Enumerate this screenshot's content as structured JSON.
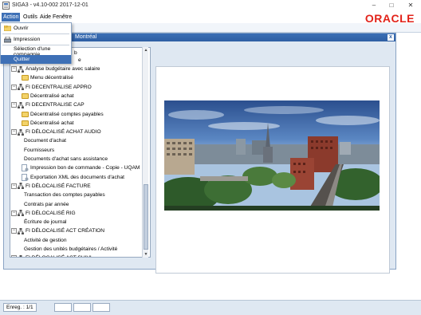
{
  "window": {
    "title": "SIGA3 - v4.10-002 2017-12-01",
    "controls": {
      "minimize": "–",
      "maximize": "□",
      "close": "✕"
    }
  },
  "menubar": {
    "items": [
      "Action",
      "Outils",
      "Aide",
      "Fenêtre"
    ],
    "active": "Action",
    "logo": "ORACLE"
  },
  "dropdown": {
    "items": [
      {
        "label": "Ouvrir",
        "icon": "folder-open-icon"
      },
      {
        "label": "Impression",
        "icon": "printer-icon"
      },
      {
        "label": "Sélection d'une compagnie"
      },
      {
        "label": "Quitter",
        "selected": true
      }
    ]
  },
  "inner_window": {
    "title": "Montréal",
    "close": "x"
  },
  "tree": {
    "partial_rows": [
      "b",
      "e"
    ],
    "items": [
      {
        "label": "Analyse budgétaire avec salaire",
        "level": 0,
        "type": "hierarchy"
      },
      {
        "label": "Menu décentralisé",
        "level": 1,
        "type": "folder"
      },
      {
        "label": "FI DECENTRALISE APPRO",
        "level": 0,
        "type": "hierarchy"
      },
      {
        "label": "Décentralisé achat",
        "level": 1,
        "type": "folder"
      },
      {
        "label": "FI DECENTRALISE CAP",
        "level": 0,
        "type": "hierarchy"
      },
      {
        "label": "Décentralisé comptes payables",
        "level": 1,
        "type": "folder"
      },
      {
        "label": "Décentralisé achat",
        "level": 1,
        "type": "folder"
      },
      {
        "label": "FI DÉLOCALISÉ ACHAT AUDIO",
        "level": 0,
        "type": "hierarchy"
      },
      {
        "label": "Document d'achat",
        "level": 1,
        "type": "leaf"
      },
      {
        "label": "Fournisseurs",
        "level": 1,
        "type": "leaf"
      },
      {
        "label": "Documents d'achat sans assistance",
        "level": 1,
        "type": "leaf"
      },
      {
        "label": "Impression bon de commande - Copie - UQAM",
        "level": 1,
        "type": "doc"
      },
      {
        "label": "Exportation XML des documents d'achat",
        "level": 1,
        "type": "doc"
      },
      {
        "label": "FI DÉLOCALISÉ FACTURE",
        "level": 0,
        "type": "hierarchy"
      },
      {
        "label": "Transaction des comptes payables",
        "level": 1,
        "type": "leaf"
      },
      {
        "label": "Contrats par année",
        "level": 1,
        "type": "leaf"
      },
      {
        "label": "FI DÉLOCALISÉ RIG",
        "level": 0,
        "type": "hierarchy"
      },
      {
        "label": "Écriture de journal",
        "level": 1,
        "type": "leaf"
      },
      {
        "label": "FI DÉLOCALISÉ ACT CRÉATION",
        "level": 0,
        "type": "hierarchy"
      },
      {
        "label": "Activité de gestion",
        "level": 1,
        "type": "leaf"
      },
      {
        "label": "Gestion des unités budgétaires / Activité",
        "level": 1,
        "type": "leaf"
      },
      {
        "label": "FI DÉLOCALISÉ ACT SUIVI",
        "level": 0,
        "type": "hierarchy"
      }
    ]
  },
  "status": {
    "record": "Enreg. : 1/1"
  },
  "colors": {
    "accent": "#3e70b6",
    "oracle_red": "#e2231a",
    "frame_bg": "#dfe8f2"
  }
}
